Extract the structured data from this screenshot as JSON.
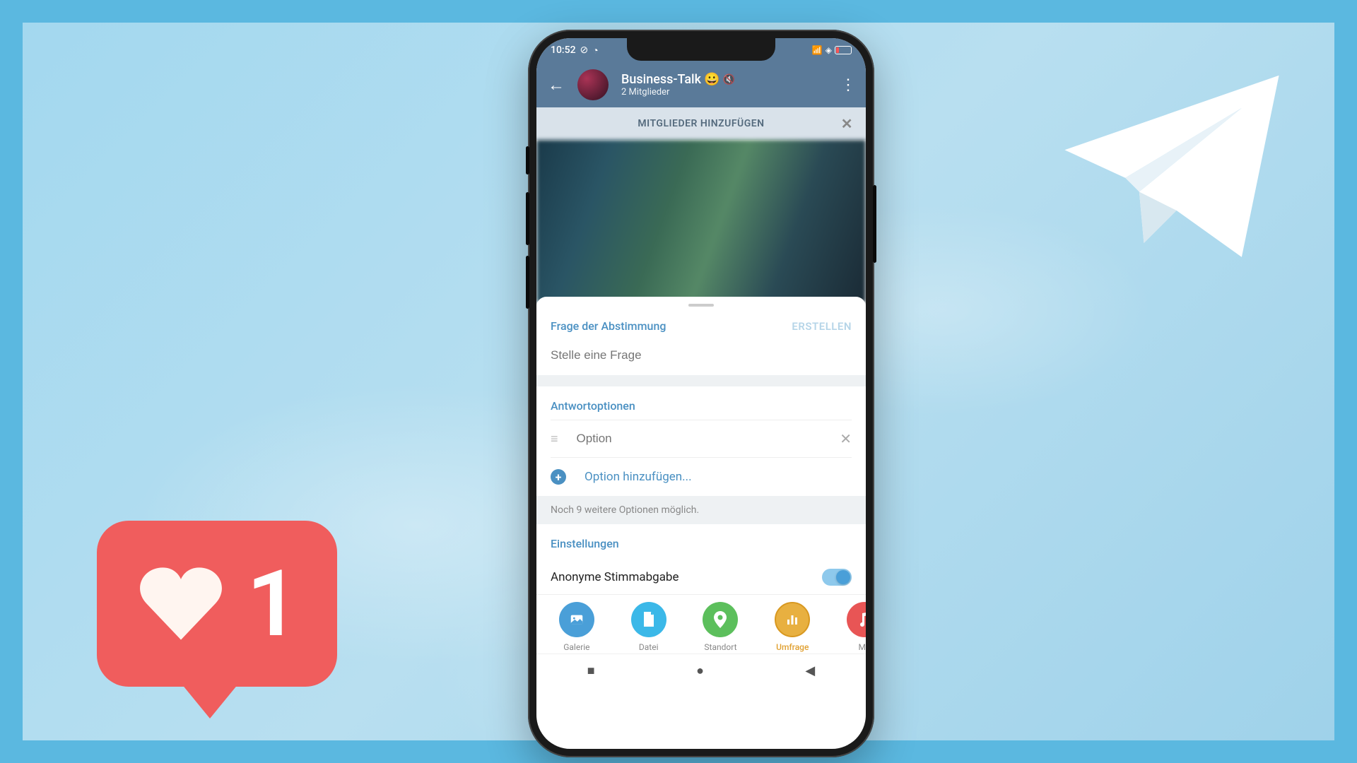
{
  "heart": {
    "count": "1"
  },
  "status": {
    "time": "10:52",
    "battery": "14"
  },
  "header": {
    "title": "Business-Talk",
    "emoji": "😀",
    "subtitle": "2 Mitglieder"
  },
  "add_members": {
    "label": "MITGLIEDER HINZUFÜGEN"
  },
  "poll": {
    "question_section": "Frage der Abstimmung",
    "create": "ERSTELLEN",
    "question_placeholder": "Stelle eine Frage",
    "answers_section": "Antwortoptionen",
    "option_placeholder": "Option",
    "add_option": "Option hinzufügen...",
    "remaining_hint": "Noch 9 weitere Optionen möglich.",
    "settings_section": "Einstellungen",
    "anonymous": "Anonyme Stimmabgabe"
  },
  "attach": {
    "gallery": "Galerie",
    "file": "Datei",
    "location": "Standort",
    "poll": "Umfrage",
    "music": "Mu"
  }
}
